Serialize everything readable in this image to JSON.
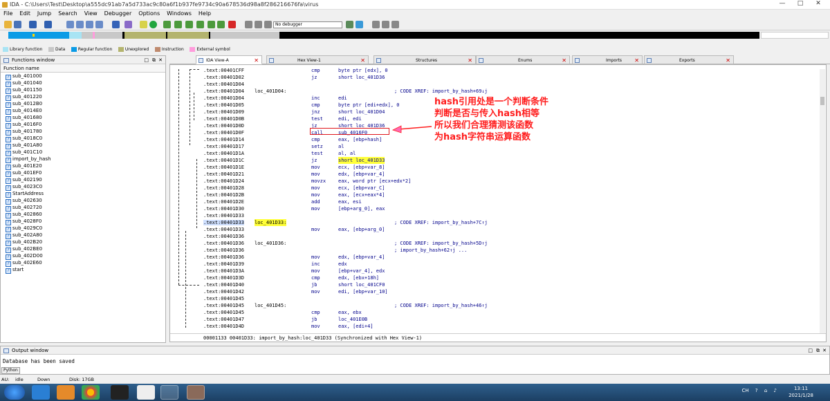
{
  "window": {
    "title": "IDA - C:\\Users\\Test\\Desktop\\a555dc91ab7a5d733ac9c80a6f1b937fe9734c90a678536d98a8f286216676fa\\virus",
    "controls": [
      "—",
      "□",
      "✕"
    ]
  },
  "menu": [
    "File",
    "Edit",
    "Jump",
    "Search",
    "View",
    "Debugger",
    "Options",
    "Windows",
    "Help"
  ],
  "toolbar": {
    "debugger_select": "No debugger"
  },
  "legend": [
    {
      "label": "Library function",
      "color": "#a8e4f4"
    },
    {
      "label": "Data",
      "color": "#c8c8c8"
    },
    {
      "label": "Regular function",
      "color": "#0a9be6"
    },
    {
      "label": "Unexplored",
      "color": "#b4b46e"
    },
    {
      "label": "Instruction",
      "color": "#bf8a6e"
    },
    {
      "label": "External symbol",
      "color": "#ff9cdc"
    }
  ],
  "functions_panel": {
    "title": "Functions window",
    "column_header": "Function name",
    "items": [
      "sub_401000",
      "sub_401040",
      "sub_401150",
      "sub_401220",
      "sub_4012B0",
      "sub_4014E0",
      "sub_401680",
      "sub_4016F0",
      "sub_401780",
      "sub_4018C0",
      "sub_401A80",
      "sub_401C10",
      "import_by_hash",
      "sub_401E20",
      "sub_401EF0",
      "sub_402190",
      "sub_4023C0",
      "StartAddress",
      "sub_402630",
      "sub_402720",
      "sub_402860",
      "sub_4028F0",
      "sub_4029C0",
      "sub_402A80",
      "sub_402B20",
      "sub_402BE0",
      "sub_402D00",
      "sub_402E60",
      "start"
    ]
  },
  "tabs": [
    {
      "label": "IDA View-A",
      "active": true
    },
    {
      "label": "Hex View-1",
      "active": false
    },
    {
      "label": "Structures",
      "active": false
    },
    {
      "label": "Enums",
      "active": false
    },
    {
      "label": "Imports",
      "active": false
    },
    {
      "label": "Exports",
      "active": false
    }
  ],
  "code_lines": [
    {
      "addr": ".text:00401CFF",
      "label": "",
      "mnem": "cmp",
      "ops": "byte ptr [edx], 0",
      "cmt": ""
    },
    {
      "addr": ".text:00401D02",
      "label": "",
      "mnem": "jz",
      "ops": "short loc_401D36",
      "cmt": ""
    },
    {
      "addr": ".text:00401D04",
      "label": "",
      "mnem": "",
      "ops": "",
      "cmt": ""
    },
    {
      "addr": ".text:00401D04",
      "label": "loc_401D04:",
      "mnem": "",
      "ops": "",
      "cmt": "; CODE XREF: import_by_hash+69↓j"
    },
    {
      "addr": ".text:00401D04",
      "label": "",
      "mnem": "inc",
      "ops": "edi",
      "cmt": ""
    },
    {
      "addr": ".text:00401D05",
      "label": "",
      "mnem": "cmp",
      "ops": "byte ptr [edi+edx], 0",
      "cmt": ""
    },
    {
      "addr": ".text:00401D09",
      "label": "",
      "mnem": "jnz",
      "ops": "short loc_401D04",
      "cmt": ""
    },
    {
      "addr": ".text:00401D0B",
      "label": "",
      "mnem": "test",
      "ops": "edi, edi",
      "cmt": ""
    },
    {
      "addr": ".text:00401D0D",
      "label": "",
      "mnem": "jz",
      "ops": "short loc_401D36",
      "cmt": ""
    },
    {
      "addr": ".text:00401D0F",
      "label": "",
      "mnem": "call",
      "ops": "sub_4016F0",
      "cmt": ""
    },
    {
      "addr": ".text:00401D14",
      "label": "",
      "mnem": "cmp",
      "ops": "eax, [ebp+hash]",
      "cmt": ""
    },
    {
      "addr": ".text:00401D17",
      "label": "",
      "mnem": "setz",
      "ops": "al",
      "cmt": ""
    },
    {
      "addr": ".text:00401D1A",
      "label": "",
      "mnem": "test",
      "ops": "al, al",
      "cmt": ""
    },
    {
      "addr": ".text:00401D1C",
      "label": "",
      "mnem": "jz",
      "ops": "short loc_401D33",
      "cmt": "",
      "hl_ops": true
    },
    {
      "addr": ".text:00401D1E",
      "label": "",
      "mnem": "mov",
      "ops": "ecx, [ebp+var_8]",
      "cmt": ""
    },
    {
      "addr": ".text:00401D21",
      "label": "",
      "mnem": "mov",
      "ops": "edx, [ebp+var_4]",
      "cmt": ""
    },
    {
      "addr": ".text:00401D24",
      "label": "",
      "mnem": "movzx",
      "ops": "eax, word ptr [ecx+edx*2]",
      "cmt": ""
    },
    {
      "addr": ".text:00401D28",
      "label": "",
      "mnem": "mov",
      "ops": "ecx, [ebp+var_C]",
      "cmt": ""
    },
    {
      "addr": ".text:00401D2B",
      "label": "",
      "mnem": "mov",
      "ops": "eax, [ecx+eax*4]",
      "cmt": ""
    },
    {
      "addr": ".text:00401D2E",
      "label": "",
      "mnem": "add",
      "ops": "eax, esi",
      "cmt": ""
    },
    {
      "addr": ".text:00401D30",
      "label": "",
      "mnem": "mov",
      "ops": "[ebp+arg_0], eax",
      "cmt": ""
    },
    {
      "addr": ".text:00401D33",
      "label": "",
      "mnem": "",
      "ops": "",
      "cmt": ""
    },
    {
      "addr": ".text:00401D33",
      "label": "loc_401D33:",
      "mnem": "",
      "ops": "",
      "cmt": "; CODE XREF: import_by_hash+7C↑j",
      "hl_label": true,
      "selected": true
    },
    {
      "addr": ".text:00401D33",
      "label": "",
      "mnem": "mov",
      "ops": "eax, [ebp+arg_0]",
      "cmt": ""
    },
    {
      "addr": ".text:00401D36",
      "label": "",
      "mnem": "",
      "ops": "",
      "cmt": ""
    },
    {
      "addr": ".text:00401D36",
      "label": "loc_401D36:",
      "mnem": "",
      "ops": "",
      "cmt": "; CODE XREF: import_by_hash+5D↑j"
    },
    {
      "addr": ".text:00401D36",
      "label": "",
      "mnem": "",
      "ops": "",
      "cmt": "; import_by_hash+62↑j ..."
    },
    {
      "addr": ".text:00401D36",
      "label": "",
      "mnem": "mov",
      "ops": "edx, [ebp+var_4]",
      "cmt": ""
    },
    {
      "addr": ".text:00401D39",
      "label": "",
      "mnem": "inc",
      "ops": "edx",
      "cmt": ""
    },
    {
      "addr": ".text:00401D3A",
      "label": "",
      "mnem": "mov",
      "ops": "[ebp+var_4], edx",
      "cmt": ""
    },
    {
      "addr": ".text:00401D3D",
      "label": "",
      "mnem": "cmp",
      "ops": "edx, [ebx+18h]",
      "cmt": ""
    },
    {
      "addr": ".text:00401D40",
      "label": "",
      "mnem": "jb",
      "ops": "short loc_401CF0",
      "cmt": ""
    },
    {
      "addr": ".text:00401D42",
      "label": "",
      "mnem": "mov",
      "ops": "edi, [ebp+var_10]",
      "cmt": ""
    },
    {
      "addr": ".text:00401D45",
      "label": "",
      "mnem": "",
      "ops": "",
      "cmt": ""
    },
    {
      "addr": ".text:00401D45",
      "label": "loc_401D45:",
      "mnem": "",
      "ops": "",
      "cmt": "; CODE XREF: import_by_hash+46↑j"
    },
    {
      "addr": ".text:00401D45",
      "label": "",
      "mnem": "cmp",
      "ops": "eax, ebx",
      "cmt": ""
    },
    {
      "addr": ".text:00401D47",
      "label": "",
      "mnem": "jb",
      "ops": "loc_401E0B",
      "cmt": ""
    },
    {
      "addr": ".text:00401D4D",
      "label": "",
      "mnem": "mov",
      "ops": "eax, [edi+4]",
      "cmt": ""
    }
  ],
  "annotation": {
    "lines": [
      "hash引用处是一个判断条件",
      "判断是否与传入hash相等",
      "所以我们合理猜测该函数",
      "为hash字符串运算函数"
    ],
    "color": "#ff1e1e"
  },
  "code_status": "00001133 00401D33: import_by_hash:loc_401D33 (Synchronized with Hex View-1)",
  "output_panel": {
    "title": "Output window",
    "text": "Database has been saved",
    "python_button": "Python"
  },
  "statusbar": {
    "au": "AU:",
    "state": "idle",
    "direction": "Down",
    "disk": "Disk: 17GB"
  },
  "taskbar": {
    "tray": [
      "CH",
      "?",
      "⌂",
      "♪"
    ],
    "time": "13:11",
    "date": "2021/1/28"
  }
}
